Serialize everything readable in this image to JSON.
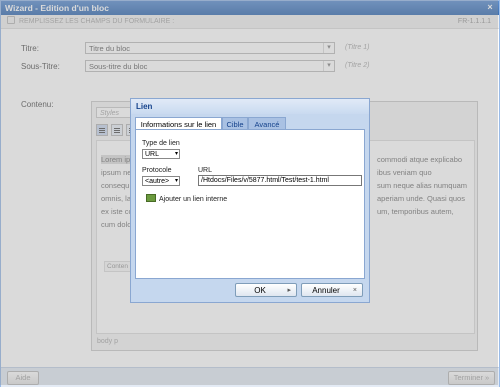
{
  "window": {
    "title": "Wizard - Edition d'un bloc",
    "instruction": "REMPLISSEZ LES CHAMPS DU FORMULAIRE :",
    "step": "FR-1.1.1.1"
  },
  "form": {
    "title_label": "Titre:",
    "title_value": "Titre du bloc",
    "title_hint": "(Titre 1)",
    "subtitle_label": "Sous-Titre:",
    "subtitle_value": "Sous-titre du bloc",
    "subtitle_hint": "(Titre 2)",
    "content_label": "Contenu:"
  },
  "editor": {
    "styles_placeholder": "Styles",
    "text_left": [
      "Lorem ip",
      "ipsum ne",
      "consequ",
      "omnis, la",
      "ex iste co",
      "cum dolo"
    ],
    "text_right": [
      "commodi atque explicabo",
      "ibus veniam quo",
      "sum neque alias numquam",
      "aperiam unde. Quasi quos",
      "um, temporibus autem,",
      ""
    ],
    "mini_label": "Conten",
    "path": "body  p"
  },
  "footer": {
    "help_label": "Aide",
    "finish_label": "Terminer »"
  },
  "dialog": {
    "title": "Lien",
    "tabs": [
      "Informations sur le lien",
      "Cible",
      "Avancé"
    ],
    "link_type_label": "Type de lien",
    "link_type_value": "URL",
    "protocol_label": "Protocole",
    "protocol_value": "<autre>",
    "url_label": "URL",
    "url_value": "/Htdocs/Files/v/5877.html/Test/test-1.html",
    "internal_link_label": "Ajouter un lien interne",
    "ok_label": "OK",
    "cancel_label": "Annuler"
  }
}
